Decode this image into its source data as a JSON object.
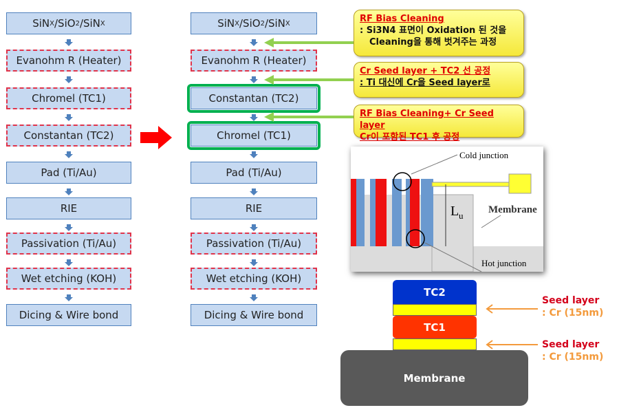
{
  "left_flow": [
    {
      "label": "SiNx/SiO2/SiNx",
      "style": "solid"
    },
    {
      "label": "Evanohm R (Heater)",
      "style": "dashed"
    },
    {
      "label": "Chromel (TC1)",
      "style": "dashed"
    },
    {
      "label": "Constantan (TC2)",
      "style": "dashed"
    },
    {
      "label": "Pad (Ti/Au)",
      "style": "solid"
    },
    {
      "label": "RIE",
      "style": "solid"
    },
    {
      "label": "Passivation (Ti/Au)",
      "style": "dashed"
    },
    {
      "label": "Wet etching (KOH)",
      "style": "dashed"
    },
    {
      "label": "Dicing & Wire bond",
      "style": "solid"
    }
  ],
  "right_flow": [
    {
      "label": "SiNx/SiO2/SiNx",
      "style": "solid"
    },
    {
      "label": "Evanohm R (Heater)",
      "style": "dashed"
    },
    {
      "label": "Constantan (TC2)",
      "style": "highlight"
    },
    {
      "label": "Chromel (TC1)",
      "style": "highlight"
    },
    {
      "label": "Pad (Ti/Au)",
      "style": "solid"
    },
    {
      "label": "RIE",
      "style": "solid"
    },
    {
      "label": "Passivation (Ti/Au)",
      "style": "dashed"
    },
    {
      "label": "Wet etching (KOH)",
      "style": "dashed"
    },
    {
      "label": "Dicing & Wire bond",
      "style": "solid"
    }
  ],
  "callouts": [
    {
      "title": "RF Bias  Cleaning",
      "body": ": Si3N4 표면이 Oxidation 된 것을",
      "body2": "Cleaning을 통해 벗겨주는 과정"
    },
    {
      "title": "Cr Seed layer + TC2 선 공정",
      "body": ": Ti 대신에 Cr을 Seed layer로"
    },
    {
      "title": "RF Bias Cleaning+ Cr Seed  layer",
      "title2": "Cr이 포함된 TC1 후 공정"
    }
  ],
  "figure": {
    "cold": "Cold junction",
    "hot": "Hot junction",
    "membrane": "Membrane",
    "length": "L",
    "length_sub": "u"
  },
  "stack": {
    "tc2": "TC2",
    "tc1": "TC1",
    "membrane": "Membrane",
    "seeds": [
      {
        "title": "Seed layer",
        "detail": ": Cr (15nm)"
      },
      {
        "title": "Seed layer",
        "detail": ": Cr (15nm)"
      }
    ]
  },
  "colors": {
    "highlight": "#00b050",
    "arrow": "#ff0000",
    "tc2": "#0033cc",
    "tc1": "#ff3300",
    "seed": "#ffff00",
    "membrane": "#595959"
  }
}
